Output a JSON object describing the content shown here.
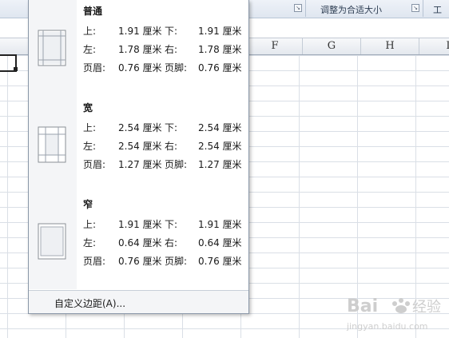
{
  "ribbon": {
    "group_label": "调整为合适大小",
    "right_label": "工"
  },
  "columns": [
    "F",
    "G",
    "H",
    "I"
  ],
  "margins_menu": {
    "presets": [
      {
        "title": "普通",
        "rows": [
          {
            "k1": "上:",
            "v1": "1.91 厘米",
            "k2": "下:",
            "v2": "1.91 厘米"
          },
          {
            "k1": "左:",
            "v1": "1.78 厘米",
            "k2": "右:",
            "v2": "1.78 厘米"
          },
          {
            "k1": "页眉:",
            "v1": "0.76 厘米",
            "k2": "页脚:",
            "v2": "0.76 厘米"
          }
        ]
      },
      {
        "title": "宽",
        "rows": [
          {
            "k1": "上:",
            "v1": "2.54 厘米",
            "k2": "下:",
            "v2": "2.54 厘米"
          },
          {
            "k1": "左:",
            "v1": "2.54 厘米",
            "k2": "右:",
            "v2": "2.54 厘米"
          },
          {
            "k1": "页眉:",
            "v1": "1.27 厘米",
            "k2": "页脚:",
            "v2": "1.27 厘米"
          }
        ]
      },
      {
        "title": "窄",
        "rows": [
          {
            "k1": "上:",
            "v1": "1.91 厘米",
            "k2": "下:",
            "v2": "1.91 厘米"
          },
          {
            "k1": "左:",
            "v1": "0.64 厘米",
            "k2": "右:",
            "v2": "0.64 厘米"
          },
          {
            "k1": "页眉:",
            "v1": "0.76 厘米",
            "k2": "页脚:",
            "v2": "0.76 厘米"
          }
        ]
      }
    ],
    "custom_label": "自定义边距(A)..."
  },
  "watermark": {
    "line1": "Bai",
    "line2": "经验",
    "line3": "jingyan.baidu.com"
  }
}
